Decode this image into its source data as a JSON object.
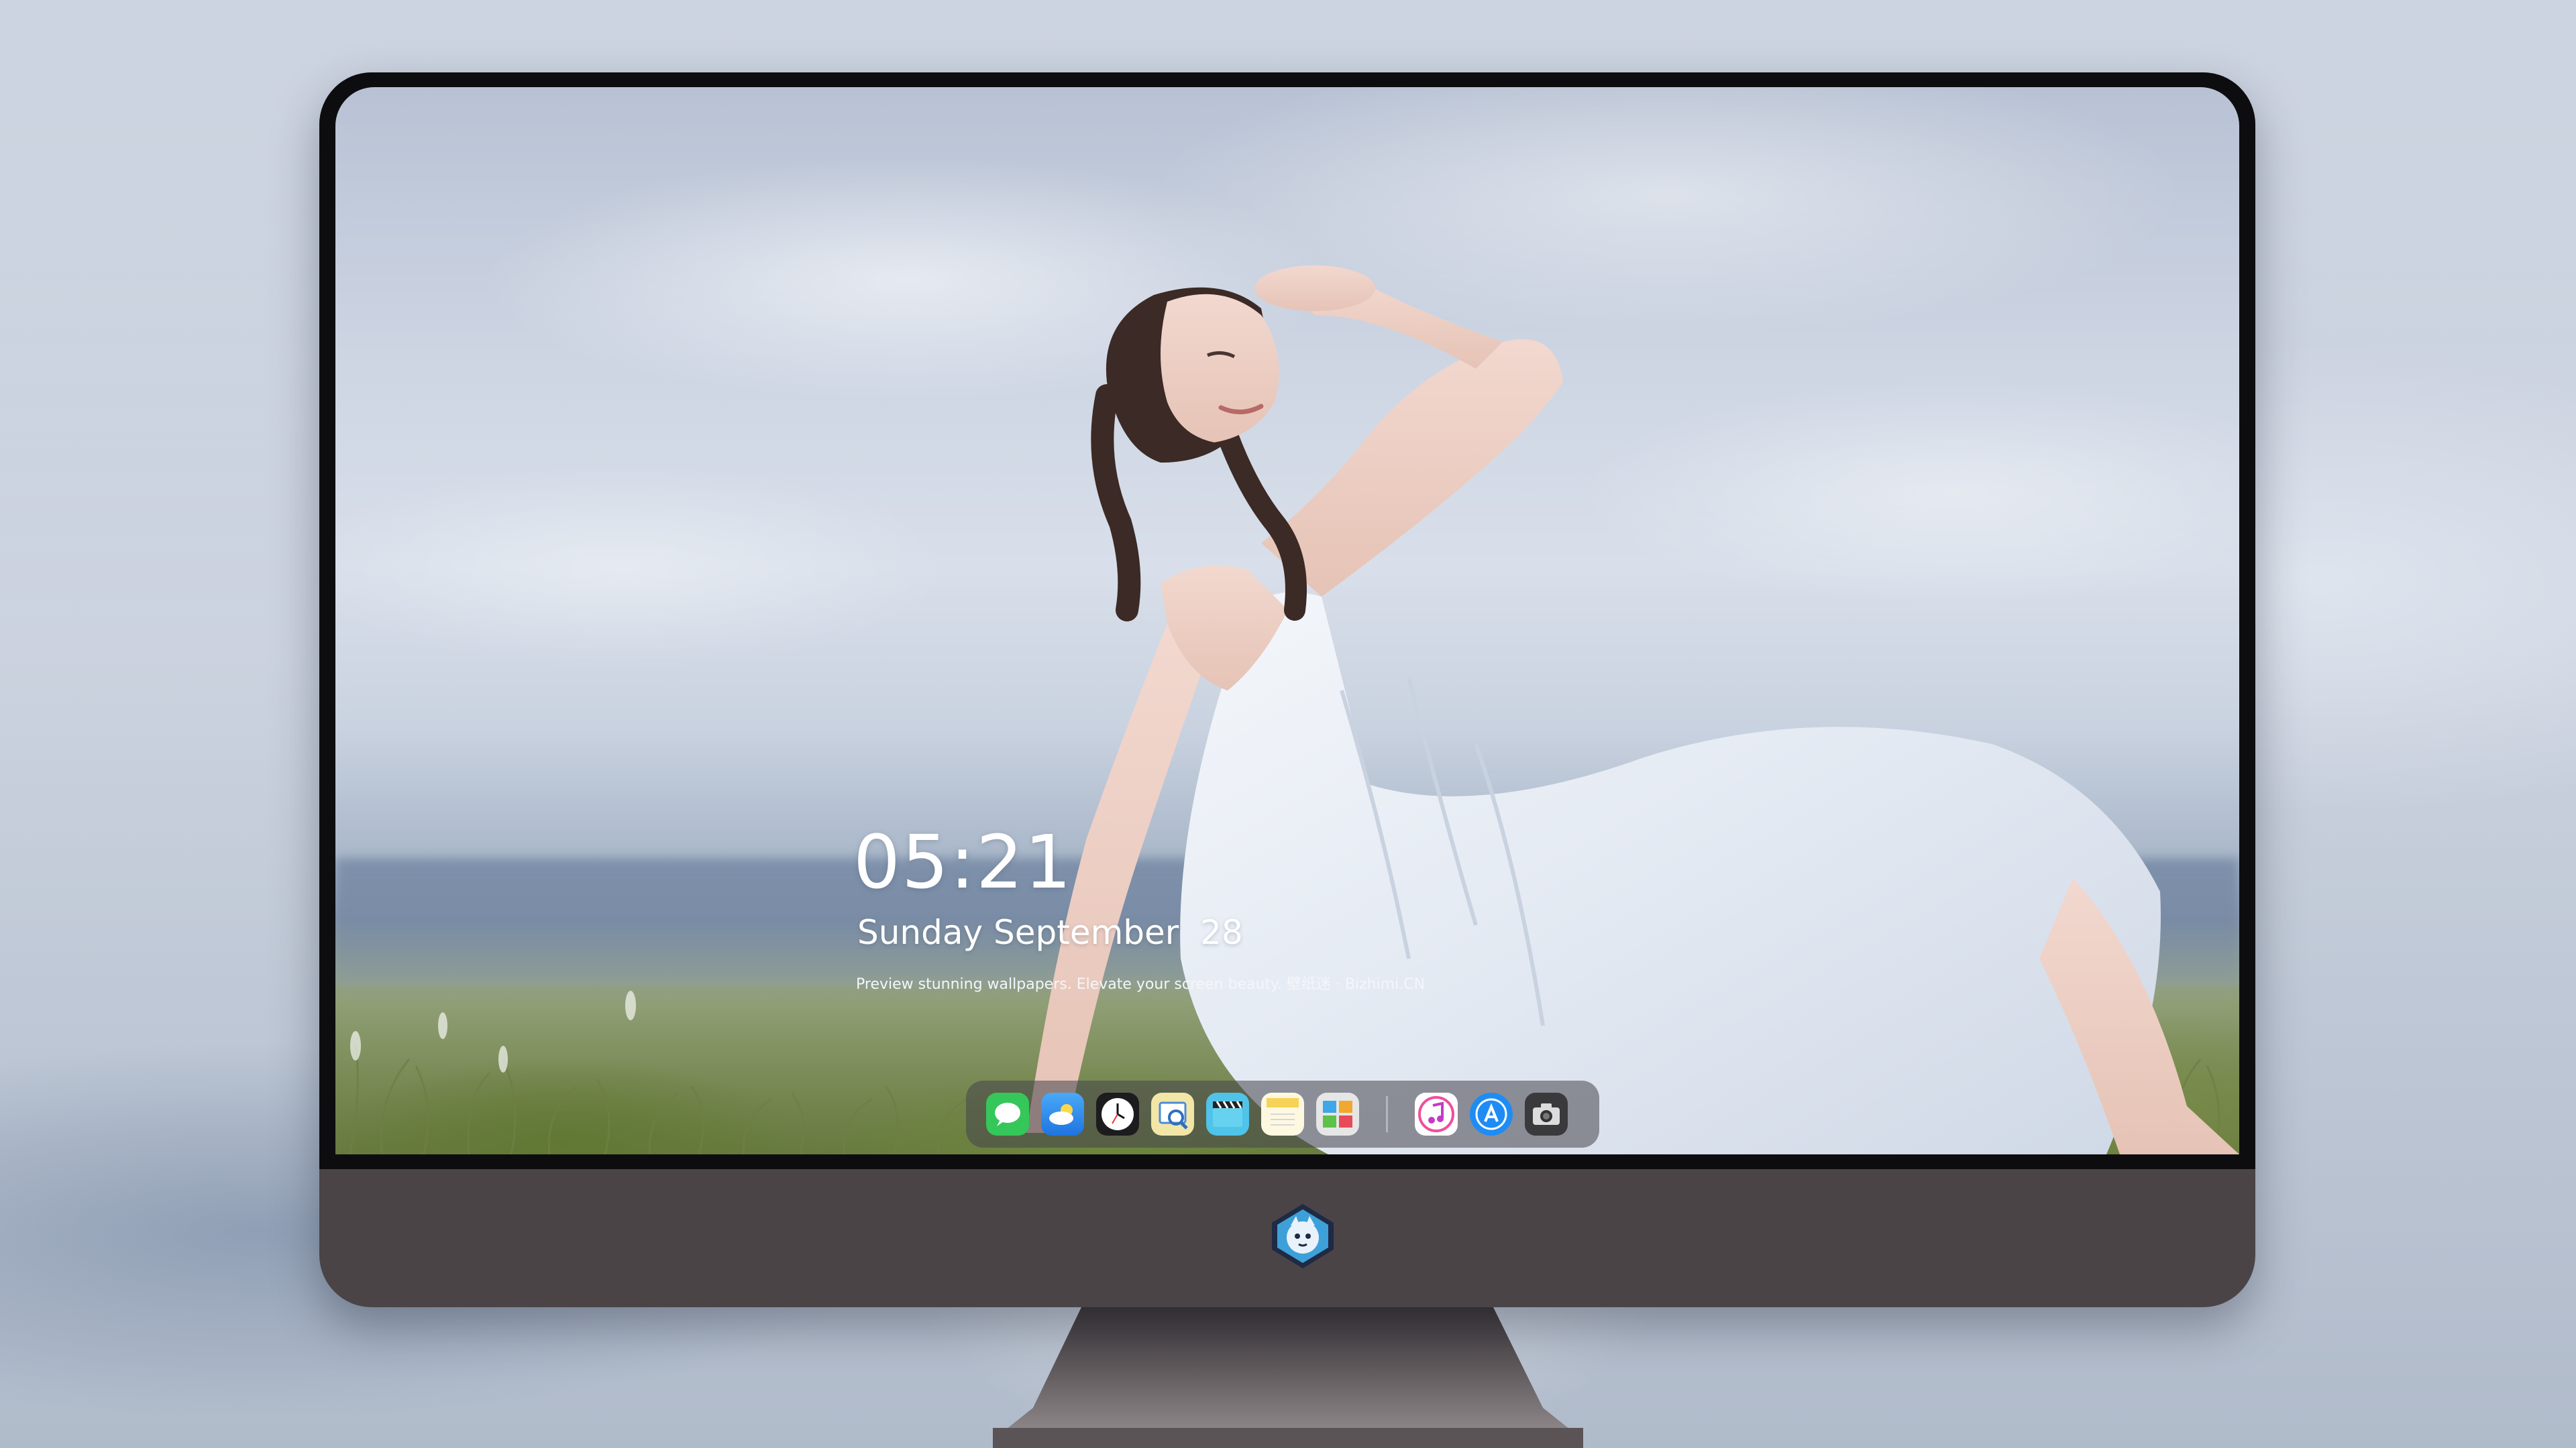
{
  "lock_screen": {
    "time": "05:21",
    "date": "Sunday September  28",
    "tagline": "Preview stunning wallpapers. Elevate your screen beauty. 壁纸迷 · Bizhimi.CN"
  },
  "dock": {
    "apps": [
      {
        "name": "messages-icon",
        "color": "#35c759"
      },
      {
        "name": "weather-icon",
        "color": "#2f8cf0"
      },
      {
        "name": "clock-icon",
        "color": "#1c1c1e"
      },
      {
        "name": "preview-icon",
        "color": "#e8d88a"
      },
      {
        "name": "clips-icon",
        "color": "#4fc3e8"
      },
      {
        "name": "notes-icon",
        "color": "#f6d357"
      },
      {
        "name": "photos-app-icon",
        "color": "#e6e6e6"
      },
      {
        "name": "music-icon",
        "color": "#f04f9c"
      },
      {
        "name": "app-store-icon",
        "color": "#1e8cf5"
      },
      {
        "name": "camera-icon",
        "color": "#3a3a3c"
      }
    ]
  },
  "chin_logo": "bizhimi-mascot-logo"
}
